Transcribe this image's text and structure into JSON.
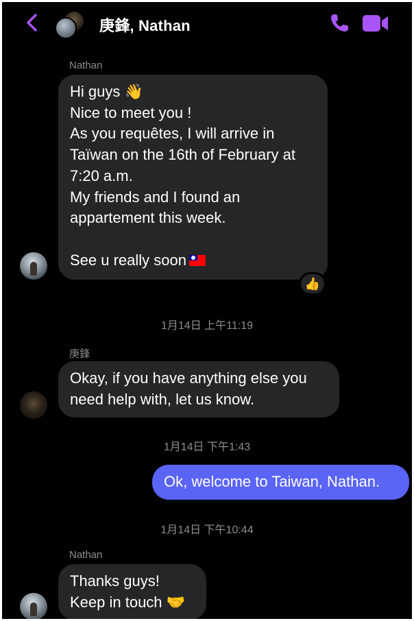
{
  "header": {
    "title": "庚鋒, Nathan",
    "accent": "#a855f7"
  },
  "messages": [
    {
      "sender": "Nathan",
      "lines": [
        "Hi guys 👋",
        "Nice to meet you !",
        "As you requêtes, I will arrive in",
        "Taïwan on the 16th of February at",
        "7:20 a.m.",
        "My friends and I found an",
        "appartement this week.",
        "",
        "See u really soon"
      ],
      "flag_icon": "taiwan-flag-icon",
      "reaction": "👍"
    },
    {
      "timestamp": "1月14日 上午11:19"
    },
    {
      "sender": "庚鋒",
      "lines": [
        "Okay, if you have anything else you",
        "need help with, let us know."
      ]
    },
    {
      "timestamp": "1月14日 下午1:43"
    },
    {
      "sender": "me",
      "lines": [
        "Ok, welcome to Taiwan, Nathan."
      ]
    },
    {
      "timestamp": "1月14日 下午10:44"
    },
    {
      "sender": "Nathan",
      "lines": [
        "Thanks guys!",
        "Keep in touch 🤝"
      ]
    }
  ],
  "colors": {
    "background": "#000000",
    "incoming_bubble": "#262628",
    "outgoing_bubble": "#5a64f6",
    "meta_text": "#8e8e93"
  },
  "icons": {
    "back": "chevron-left-icon",
    "call": "phone-icon",
    "video": "video-camera-icon"
  }
}
